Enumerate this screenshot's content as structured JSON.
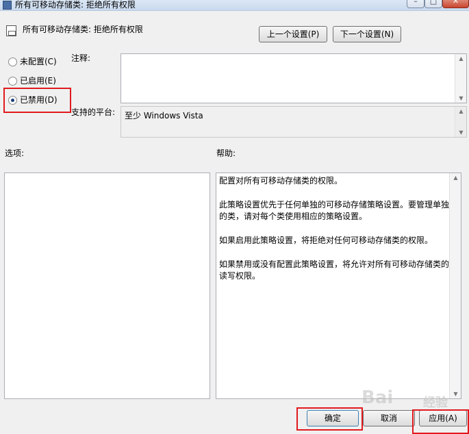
{
  "window": {
    "title": "所有可移动存储类: 拒绝所有权限",
    "minimize": "–",
    "maximize": "□",
    "close": "✕"
  },
  "header": {
    "policy_name": "所有可移动存储类: 拒绝所有权限",
    "prev_button": "上一个设置(P)",
    "next_button": "下一个设置(N)"
  },
  "state": {
    "options": [
      {
        "label": "未配置(C)",
        "checked": false
      },
      {
        "label": "已启用(E)",
        "checked": false
      },
      {
        "label": "已禁用(D)",
        "checked": true
      }
    ]
  },
  "comment": {
    "label": "注释:",
    "value": ""
  },
  "platform": {
    "label": "支持的平台:",
    "value": "至少 Windows Vista"
  },
  "sections": {
    "options_label": "选项:",
    "help_label": "帮助:"
  },
  "help": {
    "paragraphs": [
      "配置对所有可移动存储类的权限。",
      "此策略设置优先于任何单独的可移动存储策略设置。要管理单独的类，请对每个类使用相应的策略设置。",
      "如果启用此策略设置，将拒绝对任何可移动存储类的权限。",
      "如果禁用或没有配置此策略设置，将允许对所有可移动存储类的读写权限。"
    ]
  },
  "footer": {
    "ok_button": "确定",
    "cancel_button": "取消",
    "apply_button": "应用(A)"
  },
  "watermark": {
    "text": "Bai",
    "text2": "经验"
  },
  "colors": {
    "highlight": "#e0191e",
    "titlebar": "#c9d9ee"
  }
}
